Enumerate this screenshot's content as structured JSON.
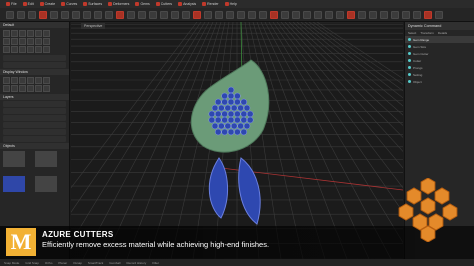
{
  "menubar": {
    "items": [
      {
        "label": "File"
      },
      {
        "label": "Edit"
      },
      {
        "label": "Create"
      },
      {
        "label": "Curves"
      },
      {
        "label": "Surfaces"
      },
      {
        "label": "Deformers"
      },
      {
        "label": "Gems"
      },
      {
        "label": "Cutters"
      },
      {
        "label": "Analysis"
      },
      {
        "label": "Render"
      },
      {
        "label": "Help"
      }
    ]
  },
  "viewport": {
    "label": "Perspective"
  },
  "right_panel": {
    "title": "Dynamic Command",
    "tabs": [
      "Select",
      "Transform",
      "Details"
    ],
    "items": [
      {
        "label": "Gem Range"
      },
      {
        "label": "Gem Size"
      },
      {
        "label": "Gem Cutter"
      },
      {
        "label": "Cutter"
      },
      {
        "label": "Prongs"
      },
      {
        "label": "Setting"
      },
      {
        "label": "Object"
      }
    ]
  },
  "left_panel": {
    "title": "Default",
    "display_title": "Display Window",
    "layers_title": "Layers",
    "objects_title": "Objects"
  },
  "banner": {
    "logo_letter": "M",
    "title": "AZURE CUTTERS",
    "text": "Efficiently remove excess material while achieving high-end finishes."
  },
  "statusbar": {
    "items": [
      "Snap Mode",
      "Grid Snap",
      "Ortho",
      "Planar",
      "Osnap",
      "SmartTrack",
      "Gumball",
      "Record History",
      "Filter"
    ]
  },
  "colors": {
    "accent": "#c0392b",
    "logo": "#f2b134",
    "gem": "#2e48b0",
    "leaf": "#6b9b78"
  }
}
